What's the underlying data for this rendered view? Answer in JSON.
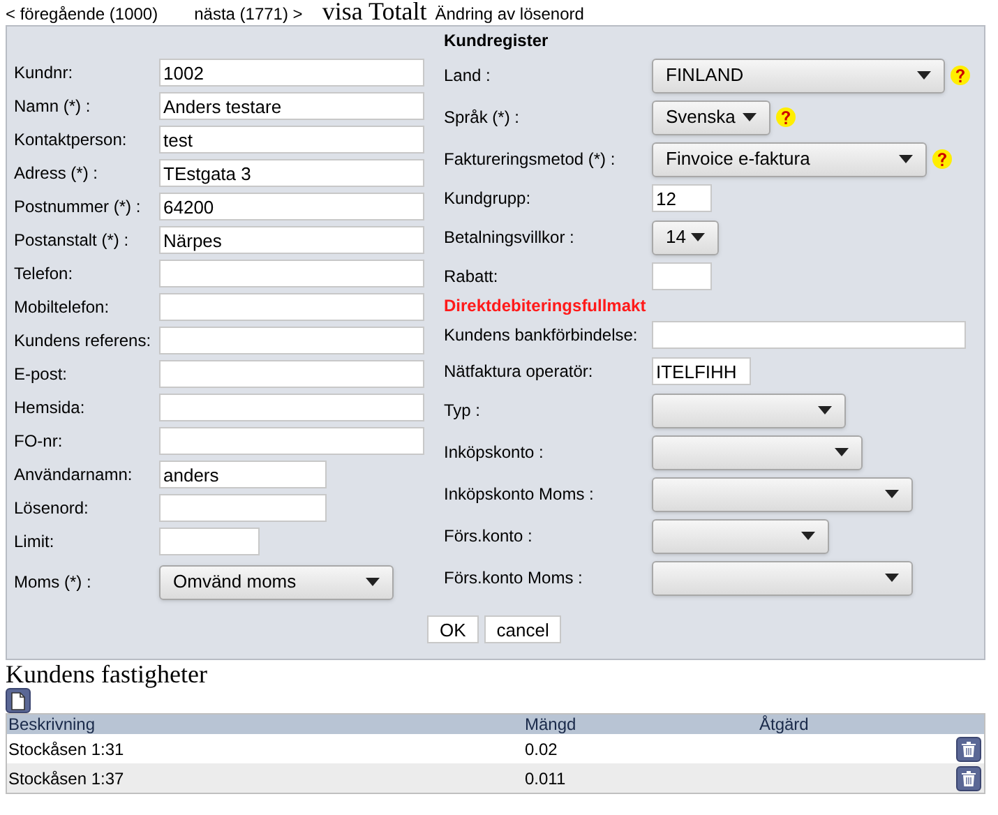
{
  "top_links": [
    {
      "label": "< föregående (1000)",
      "kind": "nav"
    },
    {
      "label": "nästa (1771) >",
      "kind": "nav"
    },
    {
      "label": "visa Totalt",
      "kind": "big"
    },
    {
      "label": "Ändring av lösenord",
      "kind": "nav"
    }
  ],
  "form": {
    "title": "Kundregister",
    "left_fields": [
      {
        "label": "Kundnr:",
        "kind": "input",
        "value": "1002"
      },
      {
        "label": "Namn (*) :",
        "kind": "input",
        "value": "Anders testare"
      },
      {
        "label": "Kontaktperson:",
        "kind": "input",
        "value": "test"
      },
      {
        "label": "Adress (*) :",
        "kind": "input",
        "value": "TEstgata 3"
      },
      {
        "label": "Postnummer (*) :",
        "kind": "input",
        "value": "64200"
      },
      {
        "label": "Postanstalt (*) :",
        "kind": "input",
        "value": "Närpes"
      },
      {
        "label": "Telefon:",
        "kind": "input"
      },
      {
        "label": "Mobiltelefon:",
        "kind": "input"
      },
      {
        "label": "Kundens referens:",
        "kind": "input"
      },
      {
        "label": "E-post:",
        "kind": "input"
      },
      {
        "label": "Hemsida:",
        "kind": "input"
      },
      {
        "label": "FO-nr:",
        "kind": "input"
      },
      {
        "label": "Användarnamn:",
        "kind": "input",
        "value": "anders"
      },
      {
        "label": "Lösenord:",
        "kind": "input"
      },
      {
        "label": "Limit:",
        "kind": "input"
      },
      {
        "label": "Moms (*) :",
        "kind": "select",
        "value": "Omvänd moms"
      }
    ],
    "right_fields": [
      {
        "label": "Land :",
        "kind": "select",
        "value": "FINLAND",
        "help": true
      },
      {
        "label": "Språk (*) :",
        "kind": "select",
        "value": "Svenska",
        "help": true
      },
      {
        "label": "Faktureringsmetod (*) :",
        "kind": "select",
        "value": "Finvoice e-faktura",
        "help": true
      },
      {
        "label": "Kundgrupp:",
        "kind": "input",
        "value": "12"
      },
      {
        "label": "Betalningsvillkor :",
        "kind": "select",
        "value": "14"
      },
      {
        "label": "Rabatt:",
        "kind": "input"
      },
      {
        "label": "Direktdebiteringsfullmakt",
        "kind": "heading"
      },
      {
        "label": "Kundens bankförbindelse:",
        "kind": "input"
      },
      {
        "label": "Nätfaktura operatör:",
        "kind": "input",
        "value": "ITELFIHH"
      },
      {
        "label": "Typ :",
        "kind": "select"
      },
      {
        "label": "Inköpskonto :",
        "kind": "select"
      },
      {
        "label": "Inköpskonto Moms :",
        "kind": "select"
      },
      {
        "label": "Förs.konto :",
        "kind": "select"
      },
      {
        "label": "Förs.konto Moms :",
        "kind": "select"
      }
    ],
    "buttons": [
      "OK",
      "cancel"
    ]
  },
  "properties": {
    "title": "Kundens fastigheter",
    "columns": [
      "Beskrivning",
      "Mängd",
      "Åtgärd"
    ],
    "rows": [
      {
        "description": "Stockåsen 1:31",
        "amount": "0.02"
      },
      {
        "description": "Stockåsen 1:37",
        "amount": "0.011"
      }
    ]
  }
}
